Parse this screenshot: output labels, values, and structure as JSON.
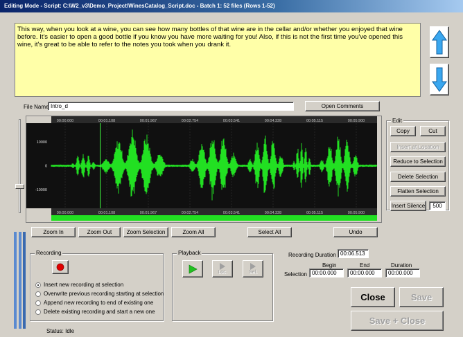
{
  "window": {
    "title": "Editing Mode - Script: C:\\W2_v3\\Demo_Project\\WinesCatalog_Script.doc - Batch 1: 52 files (Rows 1-52)"
  },
  "script": {
    "text": "This way, when you look at a wine, you can see how many bottles of that wine are in the cellar and/or whether you enjoyed that wine before. It's easier to open a good bottle if you know you have more waiting for you! Also, if this is not the first time you've opened this wine, it's great to be able to refer to the notes you took when you drank it."
  },
  "nav": {
    "up_icon": "arrow-up-icon",
    "down_icon": "arrow-down-icon",
    "color": "#3aa7ef"
  },
  "file": {
    "label": "File Name",
    "value": "Intro_d",
    "open_comments": "Open Comments"
  },
  "waveform": {
    "top_times": [
      "00:00.000",
      "00:01.108",
      "00:01.967",
      "00:02.754",
      "00:03.541",
      "00:04.328",
      "00:05.115",
      "00:05.900"
    ],
    "bottom_times": [
      "00:00.000",
      "00:01.108",
      "00:01.967",
      "00:02.754",
      "00:03.541",
      "00:04.328",
      "00:05.115",
      "00:05.900"
    ],
    "y_labels": [
      "10000",
      "0",
      "-10000"
    ],
    "wave_color": "#22e022",
    "background": "#101010"
  },
  "edit": {
    "title": "Edit",
    "copy": "Copy",
    "cut": "Cut",
    "insert_at_location": "Insert at Location",
    "reduce_to_selection": "Reduce to Selection",
    "delete_selection": "Delete Selection",
    "flatten_selection": "Flatten Selection",
    "insert_silence": "Insert Silence",
    "silence_value": "500"
  },
  "toolbar": {
    "zoom_in": "Zoom In",
    "zoom_out": "Zoom Out",
    "zoom_selection": "Zoom Selection",
    "zoom_all": "Zoom All",
    "select_all": "Select All",
    "undo": "Undo"
  },
  "recording": {
    "title": "Recording",
    "options": [
      "Insert new recording at selection",
      "Overwrite previous recording starting at selection",
      "Append new recording to end of existing one",
      "Delete existing recording and start a new one"
    ],
    "selected_index": 0,
    "status": "Status: Idle"
  },
  "playback": {
    "title": "Playback",
    "loc": "Loc.",
    "sel": "Sel."
  },
  "timing": {
    "duration_label": "Recording Duration",
    "duration_value": "00:06.513",
    "selection_label": "Selection",
    "begin_label": "Begin",
    "end_label": "End",
    "duration_col_label": "Duration",
    "begin_value": "00:00.000",
    "end_value": "00:00.000",
    "duration_col_value": "00:00.000"
  },
  "actions": {
    "close": "Close",
    "save": "Save",
    "save_close": "Save + Close"
  }
}
